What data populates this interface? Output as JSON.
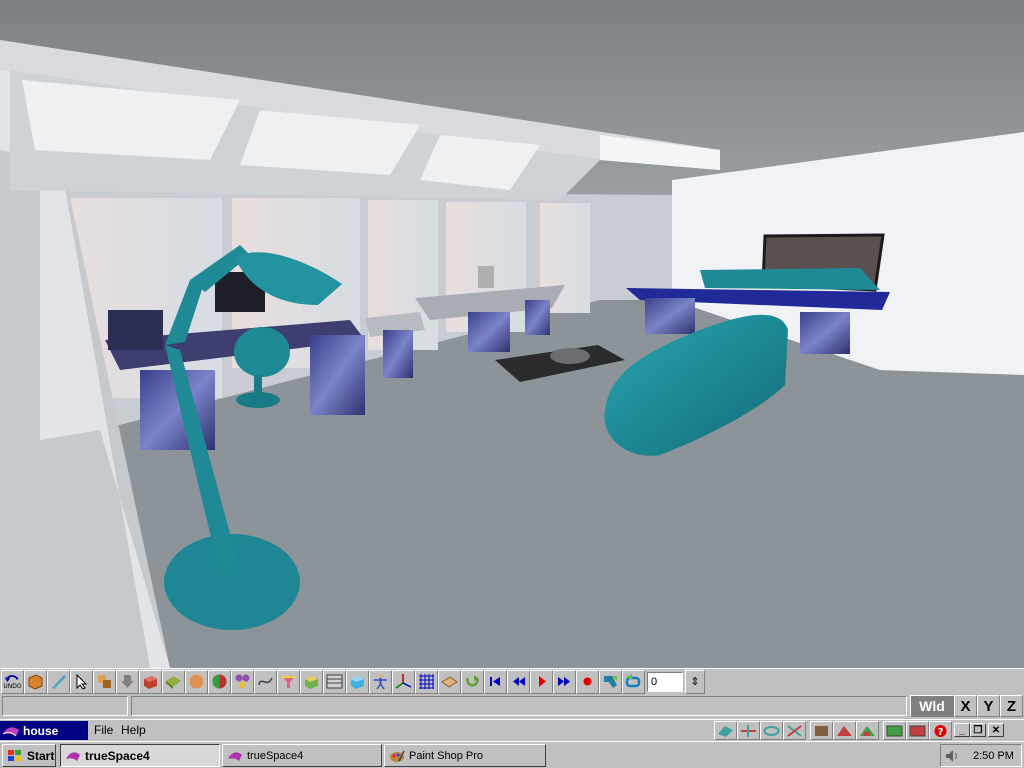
{
  "toolbar": {
    "undo_caption": "UNDO",
    "frame_value": "0",
    "spin_glyph": "⇕",
    "buttons": [
      {
        "name": "undo",
        "icon": "undo-icon"
      },
      {
        "name": "object-tool",
        "icon": "cube-icon"
      },
      {
        "name": "eyedropper-tool",
        "icon": "eyedropper-icon"
      },
      {
        "name": "select-tool",
        "icon": "arrow-cursor-icon"
      },
      {
        "name": "move-tool",
        "icon": "move-icon"
      },
      {
        "name": "drop-tool",
        "icon": "down-arrow-icon"
      },
      {
        "name": "primitive-tool",
        "icon": "box-primitive-icon"
      },
      {
        "name": "face-tool",
        "icon": "face-icon"
      },
      {
        "name": "smooth-tool",
        "icon": "sphere-icon"
      },
      {
        "name": "boolean-tool",
        "icon": "boolean-sphere-icon"
      },
      {
        "name": "group-tool",
        "icon": "group-icon"
      },
      {
        "name": "spline-tool",
        "icon": "spline-icon"
      },
      {
        "name": "paint-tool",
        "icon": "paint-icon"
      },
      {
        "name": "texture-tool",
        "icon": "texture-icon"
      },
      {
        "name": "render-tool",
        "icon": "grid-panel-icon"
      },
      {
        "name": "material-tool",
        "icon": "material-cube-icon"
      },
      {
        "name": "figure-tool",
        "icon": "figure-icon"
      },
      {
        "name": "axes-tool",
        "icon": "axes-icon"
      },
      {
        "name": "grid-tool",
        "icon": "grid-icon"
      },
      {
        "name": "camera-tool",
        "icon": "camera-icon"
      },
      {
        "name": "loop-tool",
        "icon": "loop-icon"
      },
      {
        "name": "rewind-to-start",
        "icon": "skip-back-icon"
      },
      {
        "name": "previous-frame",
        "icon": "rewind-icon"
      },
      {
        "name": "play",
        "icon": "play-icon"
      },
      {
        "name": "next-frame",
        "icon": "fast-forward-icon"
      },
      {
        "name": "record",
        "icon": "record-icon"
      },
      {
        "name": "key-tool",
        "icon": "key-icon"
      },
      {
        "name": "repeat-tool",
        "icon": "repeat-icon"
      }
    ]
  },
  "axis_buttons": {
    "world": "Wld",
    "x": "X",
    "y": "Y",
    "z": "Z"
  },
  "menu": {
    "document_title": "house",
    "file_label": "File",
    "help_label": "Help"
  },
  "view_icons": [
    "view-icon-1",
    "view-icon-2",
    "view-icon-3",
    "view-icon-4",
    "view-icon-5",
    "view-icon-6",
    "view-icon-7",
    "view-icon-8",
    "view-icon-9"
  ],
  "window_controls": {
    "minimize": "_",
    "restore": "❐",
    "close": "✕"
  },
  "taskbar": {
    "start_label": "Start",
    "tasks": [
      {
        "label": "trueSpace4",
        "active": true
      },
      {
        "label": "trueSpace4",
        "active": false
      },
      {
        "label": "Paint Shop Pro",
        "active": false
      }
    ],
    "clock": "2:50 PM"
  },
  "colors": {
    "title_bar": "#000080",
    "face": "#c0c0c0",
    "teal_furniture": "#1f8a96",
    "carpet": "#8d9499"
  }
}
